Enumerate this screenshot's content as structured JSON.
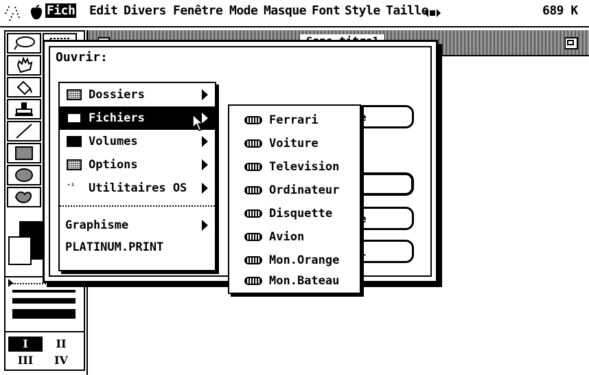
{
  "menubar": {
    "fich": "Fich",
    "items": [
      "Edit",
      "Divers",
      "Fenêtre",
      "Mode",
      "Masque",
      "Font",
      "Style",
      "Taille"
    ],
    "memory": "689 K"
  },
  "document": {
    "title": "Sans titre1"
  },
  "dialog": {
    "heading": "Ouvrir:",
    "menu": [
      {
        "label": "Dossiers",
        "icon": "folder-icon",
        "submenu": true
      },
      {
        "label": "Fichiers",
        "icon": "files-icon",
        "submenu": true,
        "highlighted": true
      },
      {
        "label": "Volumes",
        "icon": "disk-icon",
        "submenu": true
      },
      {
        "label": "Options",
        "icon": "options-icon",
        "submenu": true
      },
      {
        "label": "Utilitaires OS",
        "icon": "utilities-icon",
        "submenu": true
      },
      {
        "label": "Graphisme",
        "submenu": true
      },
      {
        "label": "PLATINUM.PRINT",
        "submenu": false
      }
    ],
    "buttons_partial": [
      "e",
      "e",
      "l"
    ]
  },
  "submenu": {
    "items": [
      "Ferrari",
      "Voiture",
      "Television",
      "Ordinateur",
      "Disquette",
      "Avion",
      "Mon.Orange",
      "Mon.Bateau"
    ],
    "icon": "file-icon"
  },
  "tools": {
    "page_labels": [
      "I",
      "II",
      "III",
      "IV"
    ]
  }
}
